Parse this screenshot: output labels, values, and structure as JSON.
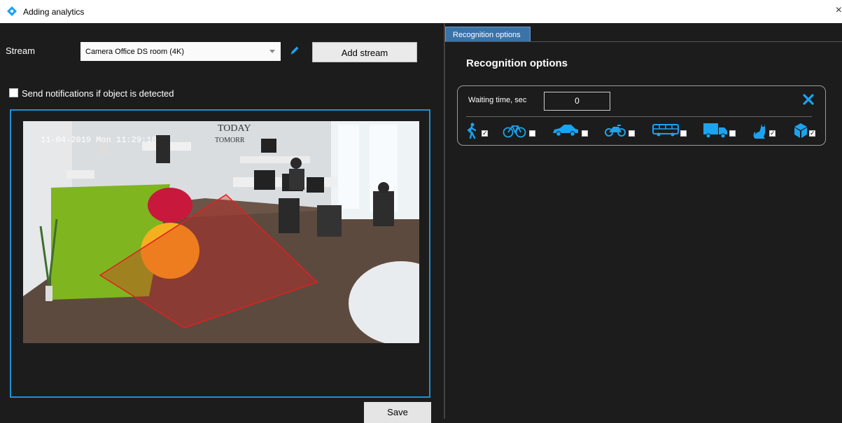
{
  "window": {
    "title": "Adding analytics",
    "close_glyph": "×"
  },
  "left_panel": {
    "stream_label": "Stream",
    "stream_value": "Camera Office DS room (4K)",
    "add_stream_label": "Add stream",
    "notify_label": "Send notifications if object is detected",
    "notify_checked": false,
    "video": {
      "timestamp": "11-04-2019 Mon 11:29:18",
      "wall_text_1": "TODAY",
      "wall_text_2": "TOMORR"
    },
    "save_label": "Save"
  },
  "right_panel": {
    "tab_label": "Recognition options",
    "title": "Recognition options",
    "waiting_label": "Waiting time, sec",
    "waiting_value": "0",
    "objects": [
      {
        "name": "person",
        "checked": true
      },
      {
        "name": "bicycle",
        "checked": false
      },
      {
        "name": "car",
        "checked": false
      },
      {
        "name": "motorcycle",
        "checked": false
      },
      {
        "name": "bus",
        "checked": false
      },
      {
        "name": "truck",
        "checked": false
      },
      {
        "name": "animal",
        "checked": true
      },
      {
        "name": "object",
        "checked": true
      }
    ]
  },
  "colors": {
    "accent": "#1e90d8",
    "icon_blue": "#1aa3f0",
    "zone_red": "#e02020",
    "tab_blue": "#3a73a8"
  }
}
